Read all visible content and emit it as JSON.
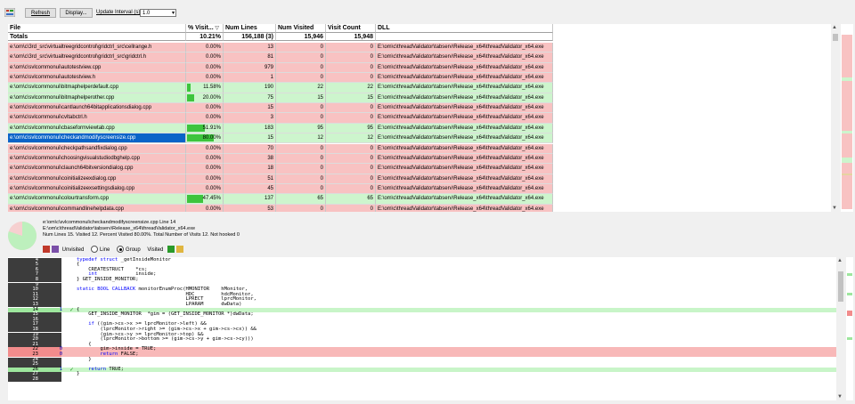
{
  "toolbar": {
    "refresh_label": "Refresh",
    "display_label": "Display...",
    "interval_label": "Update Interval (s)",
    "interval_value": "1.0"
  },
  "grid": {
    "headers": [
      "File",
      "% Visit...",
      "Num Lines",
      "Num Visited",
      "Visit Count",
      "DLL"
    ],
    "totals": {
      "label": "Totals",
      "pct": "10.21%",
      "lines": "156,188 (3)",
      "visited": "15,946",
      "count": "15,948"
    },
    "rows": [
      {
        "file": "e:\\om\\c\\3rd_src\\virtualtreegridcontrol\\gridctrl_src\\cellrange.h",
        "pct": "0.00%",
        "fill": 0,
        "lines": "13",
        "visited": "0",
        "count": "0",
        "dll": "E:\\om\\c\\threadValidator\\tabserv\\Release_x64\\threadValidator_x64.exe",
        "status": "red"
      },
      {
        "file": "e:\\om\\c\\3rd_src\\virtualtreegridcontrol\\gridctrl_src\\gridctrl.h",
        "pct": "0.00%",
        "fill": 0,
        "lines": "81",
        "visited": "0",
        "count": "0",
        "dll": "E:\\om\\c\\threadValidator\\tabserv\\Release_x64\\threadValidator_x64.exe",
        "status": "red"
      },
      {
        "file": "e:\\om\\c\\svlcommonui\\autotestview.cpp",
        "pct": "0.00%",
        "fill": 0,
        "lines": "979",
        "visited": "0",
        "count": "0",
        "dll": "E:\\om\\c\\threadValidator\\tabserv\\Release_x64\\threadValidator_x64.exe",
        "status": "red"
      },
      {
        "file": "e:\\om\\c\\svlcommonui\\autotestview.h",
        "pct": "0.00%",
        "fill": 0,
        "lines": "1",
        "visited": "0",
        "count": "0",
        "dll": "E:\\om\\c\\threadValidator\\tabserv\\Release_x64\\threadValidator_x64.exe",
        "status": "red"
      },
      {
        "file": "e:\\om\\c\\svlcommonui\\bitmaphelperdefault.cpp",
        "pct": "11.58%",
        "fill": 0.1158,
        "lines": "190",
        "visited": "22",
        "count": "22",
        "dll": "E:\\om\\c\\threadValidator\\tabserv\\Release_x64\\threadValidator_x64.exe",
        "status": "green"
      },
      {
        "file": "e:\\om\\c\\svlcommonui\\bitmaphelperother.cpp",
        "pct": "20.00%",
        "fill": 0.2,
        "lines": "75",
        "visited": "15",
        "count": "15",
        "dll": "E:\\om\\c\\threadValidator\\tabserv\\Release_x64\\threadValidator_x64.exe",
        "status": "green"
      },
      {
        "file": "e:\\om\\c\\svlcommonui\\cantlaunch64bitapplicationsdialog.cpp",
        "pct": "0.00%",
        "fill": 0,
        "lines": "15",
        "visited": "0",
        "count": "0",
        "dll": "E:\\om\\c\\threadValidator\\tabserv\\Release_x64\\threadValidator_x64.exe",
        "status": "red"
      },
      {
        "file": "e:\\om\\c\\svlcommonui\\cvltabctrl.h",
        "pct": "0.00%",
        "fill": 0,
        "lines": "3",
        "visited": "0",
        "count": "0",
        "dll": "E:\\om\\c\\threadValidator\\tabserv\\Release_x64\\threadValidator_x64.exe",
        "status": "red"
      },
      {
        "file": "e:\\om\\c\\svlcommonui\\cbaseformviewtab.cpp",
        "pct": "51.91%",
        "fill": 0.5191,
        "lines": "183",
        "visited": "95",
        "count": "95",
        "dll": "E:\\om\\c\\threadValidator\\tabserv\\Release_x64\\threadValidator_x64.exe",
        "status": "green"
      },
      {
        "file": "e:\\om\\c\\svlcommonui\\checkandmodifyscreensize.cpp",
        "pct": "80.00%",
        "fill": 0.8,
        "lines": "15",
        "visited": "12",
        "count": "12",
        "dll": "E:\\om\\c\\threadValidator\\tabserv\\Release_x64\\threadValidator_x64.exe",
        "status": "green",
        "selected": true
      },
      {
        "file": "e:\\om\\c\\svlcommonui\\checkpathsandfixdialog.cpp",
        "pct": "0.00%",
        "fill": 0,
        "lines": "70",
        "visited": "0",
        "count": "0",
        "dll": "E:\\om\\c\\threadValidator\\tabserv\\Release_x64\\threadValidator_x64.exe",
        "status": "red"
      },
      {
        "file": "e:\\om\\c\\svlcommonui\\choosingvisualstudiodbghelp.cpp",
        "pct": "0.00%",
        "fill": 0,
        "lines": "38",
        "visited": "0",
        "count": "0",
        "dll": "E:\\om\\c\\threadValidator\\tabserv\\Release_x64\\threadValidator_x64.exe",
        "status": "red"
      },
      {
        "file": "e:\\om\\c\\svlcommonui\\claunch64bitversiondialog.cpp",
        "pct": "0.00%",
        "fill": 0,
        "lines": "18",
        "visited": "0",
        "count": "0",
        "dll": "E:\\om\\c\\threadValidator\\tabserv\\Release_x64\\threadValidator_x64.exe",
        "status": "red"
      },
      {
        "file": "e:\\om\\c\\svlcommonui\\coinitializeexdialog.cpp",
        "pct": "0.00%",
        "fill": 0,
        "lines": "51",
        "visited": "0",
        "count": "0",
        "dll": "E:\\om\\c\\threadValidator\\tabserv\\Release_x64\\threadValidator_x64.exe",
        "status": "red"
      },
      {
        "file": "e:\\om\\c\\svlcommonui\\coinitializeexsettingsdialog.cpp",
        "pct": "0.00%",
        "fill": 0,
        "lines": "45",
        "visited": "0",
        "count": "0",
        "dll": "E:\\om\\c\\threadValidator\\tabserv\\Release_x64\\threadValidator_x64.exe",
        "status": "red"
      },
      {
        "file": "e:\\om\\c\\svlcommonui\\colourtransform.cpp",
        "pct": "47.45%",
        "fill": 0.4745,
        "lines": "137",
        "visited": "65",
        "count": "65",
        "dll": "E:\\om\\c\\threadValidator\\tabserv\\Release_x64\\threadValidator_x64.exe",
        "status": "green"
      },
      {
        "file": "e:\\om\\c\\svlcommonui\\commandlinehelpdata.cpp",
        "pct": "0.00%",
        "fill": 0,
        "lines": "53",
        "visited": "0",
        "count": "0",
        "dll": "E:\\om\\c\\threadValidator\\tabserv\\Release_x64\\threadValidator_x64.exe",
        "status": "red"
      }
    ]
  },
  "info": {
    "line1": "e:\\om\\c\\svlcommonui\\checkandmodifyscreensize.cpp Line 14",
    "line2": "E:\\om\\c\\threadValidator\\tabserv\\Release_x64\\threadValidator_x64.exe",
    "line3": "Num Lines   15. Visited   12. Percent Visited 80.00%. Total Number of Visits      12. Not hooked 0",
    "visited_fraction": 0.8
  },
  "legend": {
    "unvisited": "Unvisited",
    "line": "Line",
    "group": "Group",
    "visited": "Visited"
  },
  "colors": {
    "visited_green": "#c8f5c8",
    "unvisited_red": "#f8b8b8",
    "selection_blue": "#0a64c8",
    "bar_green": "#3dc43d"
  },
  "code": {
    "lines": [
      {
        "n": "4",
        "hits": "",
        "check": false,
        "status": "",
        "text": "typedef struct _getInsideMonitor"
      },
      {
        "n": "5",
        "hits": "",
        "check": false,
        "status": "",
        "text": "{"
      },
      {
        "n": "6",
        "hits": "",
        "check": false,
        "status": "",
        "text": "    CREATESTRUCT    *cs;"
      },
      {
        "n": "7",
        "hits": "",
        "check": false,
        "status": "",
        "text": "    int             inside;"
      },
      {
        "n": "8",
        "hits": "",
        "check": false,
        "status": "",
        "text": "} GET_INSIDE_MONITOR;"
      },
      {
        "n": "9",
        "hits": "",
        "check": false,
        "status": "",
        "text": ""
      },
      {
        "n": "10",
        "hits": "",
        "check": false,
        "status": "",
        "text": "static BOOL CALLBACK monitorEnumProc(HMONITOR    hMonitor,"
      },
      {
        "n": "11",
        "hits": "",
        "check": false,
        "status": "",
        "text": "                                     HDC         hdcMonitor,"
      },
      {
        "n": "12",
        "hits": "",
        "check": false,
        "status": "",
        "text": "                                     LPRECT      lprcMonitor,"
      },
      {
        "n": "13",
        "hits": "",
        "check": false,
        "status": "",
        "text": "                                     LPARAM      dwData)"
      },
      {
        "n": "14",
        "hits": "1",
        "check": true,
        "status": "green",
        "text": "{"
      },
      {
        "n": "15",
        "hits": "",
        "check": false,
        "status": "",
        "text": "    GET_INSIDE_MONITOR  *gim = (GET_INSIDE_MONITOR *)dwData;"
      },
      {
        "n": "16",
        "hits": "",
        "check": false,
        "status": "",
        "text": ""
      },
      {
        "n": "17",
        "hits": "",
        "check": false,
        "status": "",
        "text": "    if ((gim->cs->x >= lprcMonitor->left) &&"
      },
      {
        "n": "18",
        "hits": "",
        "check": false,
        "status": "",
        "text": "        (lprcMonitor->right >= (gim->cs->x + gim->cs->cx)) &&"
      },
      {
        "n": "19",
        "hits": "",
        "check": false,
        "status": "",
        "text": "        (gim->cs->y >= lprcMonitor->top) &&"
      },
      {
        "n": "20",
        "hits": "",
        "check": false,
        "status": "",
        "text": "        (lprcMonitor->bottom >= (gim->cs->y + gim->cs->cy)))"
      },
      {
        "n": "21",
        "hits": "",
        "check": false,
        "status": "",
        "text": "    {"
      },
      {
        "n": "22",
        "hits": "0",
        "check": false,
        "status": "red",
        "text": "        gim->inside = TRUE;"
      },
      {
        "n": "23",
        "hits": "0",
        "check": false,
        "status": "red",
        "text": "        return FALSE;"
      },
      {
        "n": "24",
        "hits": "",
        "check": false,
        "status": "",
        "text": "    }"
      },
      {
        "n": "25",
        "hits": "",
        "check": false,
        "status": "",
        "text": ""
      },
      {
        "n": "26",
        "hits": "1",
        "check": true,
        "status": "green",
        "text": "    return TRUE;"
      },
      {
        "n": "27",
        "hits": "",
        "check": false,
        "status": "",
        "text": "}"
      },
      {
        "n": "28",
        "hits": "",
        "check": false,
        "status": "",
        "text": ""
      }
    ]
  }
}
